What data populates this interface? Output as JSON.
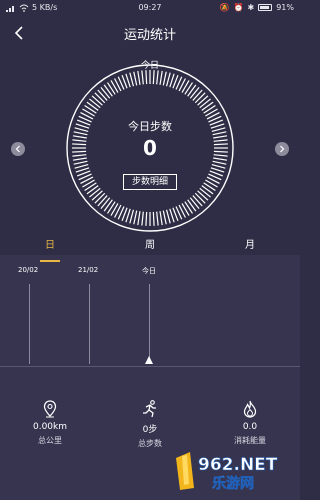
{
  "status_bar": {
    "speed": "5 KB/s",
    "time": "09:27",
    "battery": "91%",
    "battery_level": 0.91
  },
  "nav": {
    "title": "运动统计",
    "back_icon": "chevron-left-icon"
  },
  "dial": {
    "day_label": "今日",
    "title": "今日步数",
    "value": "0",
    "detail_button": "步数明细",
    "prev_icon": "chevron-left-icon",
    "next_icon": "chevron-right-icon"
  },
  "tabs": [
    {
      "label": "日",
      "active": true
    },
    {
      "label": "周",
      "active": false
    },
    {
      "label": "月",
      "active": false
    }
  ],
  "timeline": {
    "labels": [
      "20/02",
      "21/02",
      "今日"
    ]
  },
  "stats": [
    {
      "icon": "location-pin-icon",
      "value": "0.00km",
      "label": "总公里"
    },
    {
      "icon": "running-person-icon",
      "value": "0步",
      "label": "总步数"
    },
    {
      "icon": "flame-icon",
      "value": "0.0",
      "label": "消耗能量"
    }
  ],
  "watermark": {
    "text": "962.NET",
    "subtext": "乐游网"
  },
  "colors": {
    "background": "#2f2d45",
    "panel": "#36344f",
    "accent": "#e9b646"
  }
}
